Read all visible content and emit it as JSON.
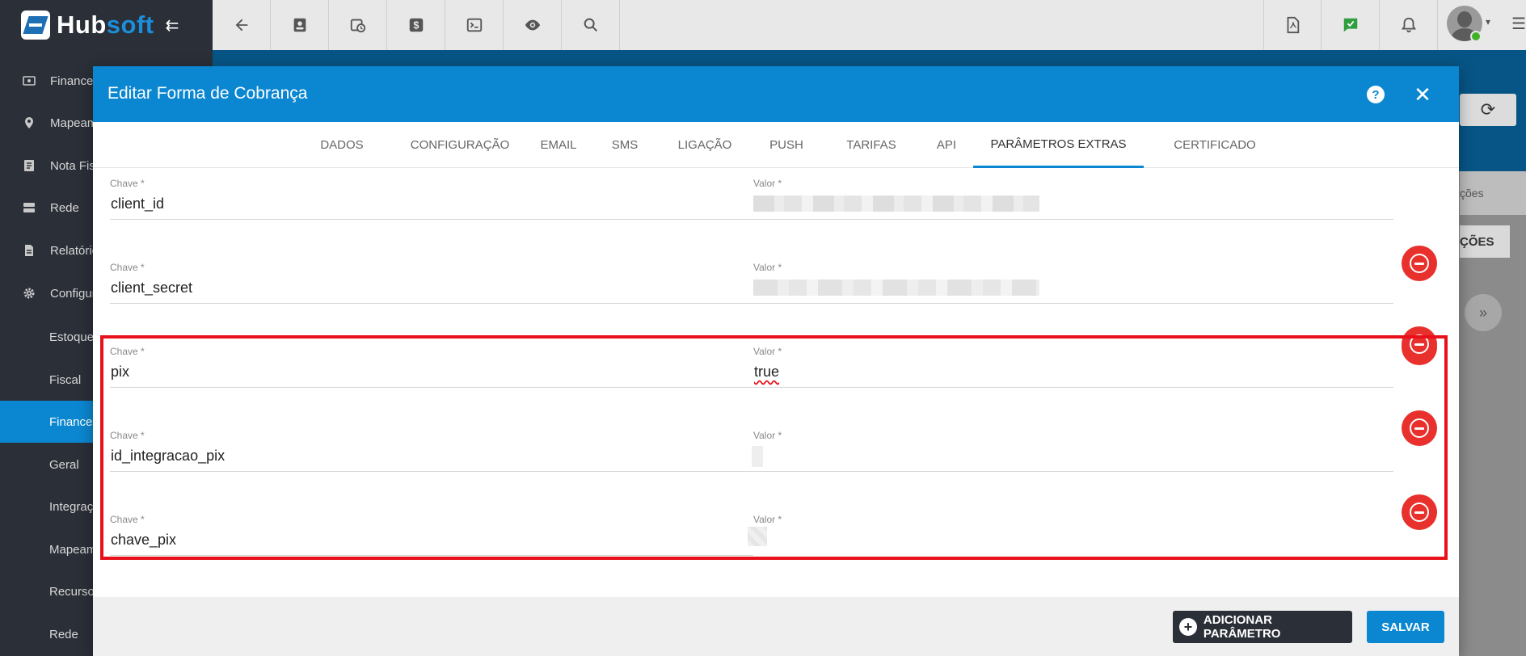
{
  "app": {
    "logo_part1": "Hub",
    "logo_part2": "soft"
  },
  "sidebar": {
    "items": [
      {
        "label": "Financei",
        "icon": "money-icon"
      },
      {
        "label": "Mapeam",
        "icon": "map-pin-icon"
      },
      {
        "label": "Nota Fis",
        "icon": "document-icon"
      },
      {
        "label": "Rede",
        "icon": "server-icon"
      },
      {
        "label": "Relatório",
        "icon": "report-icon"
      },
      {
        "label": "Configur",
        "icon": "gear-icon"
      }
    ],
    "subitems": [
      "Estoque",
      "Fiscal",
      "Financei",
      "Geral",
      "Integraçã",
      "Mapeam",
      "Recursos",
      "Rede"
    ]
  },
  "background": {
    "tab_partial": "ções",
    "button_partial": "ÇÕES"
  },
  "modal": {
    "title": "Editar Forma de Cobrança",
    "help": "?",
    "close": "✕",
    "tabs": [
      "DADOS",
      "CONFIGURAÇÃO",
      "EMAIL",
      "SMS",
      "LIGAÇÃO",
      "PUSH",
      "TARIFAS",
      "API",
      "PARÂMETROS EXTRAS",
      "CERTIFICADO"
    ],
    "active_tab": "PARÂMETROS EXTRAS",
    "key_label": "Chave *",
    "value_label": "Valor *",
    "params": [
      {
        "key": "client_id",
        "value": ""
      },
      {
        "key": "client_secret",
        "value": ""
      },
      {
        "key": "pix",
        "value": "true"
      },
      {
        "key": "id_integracao_pix",
        "value": ""
      },
      {
        "key": "chave_pix",
        "value": ""
      }
    ],
    "add_button": "ADICIONAR PARÂMETRO",
    "save_button": "SALVAR"
  },
  "colors": {
    "primary": "#0b87d1",
    "sidebar": "#2b2f38",
    "danger": "#e8312c",
    "highlight": "#e8101a"
  }
}
